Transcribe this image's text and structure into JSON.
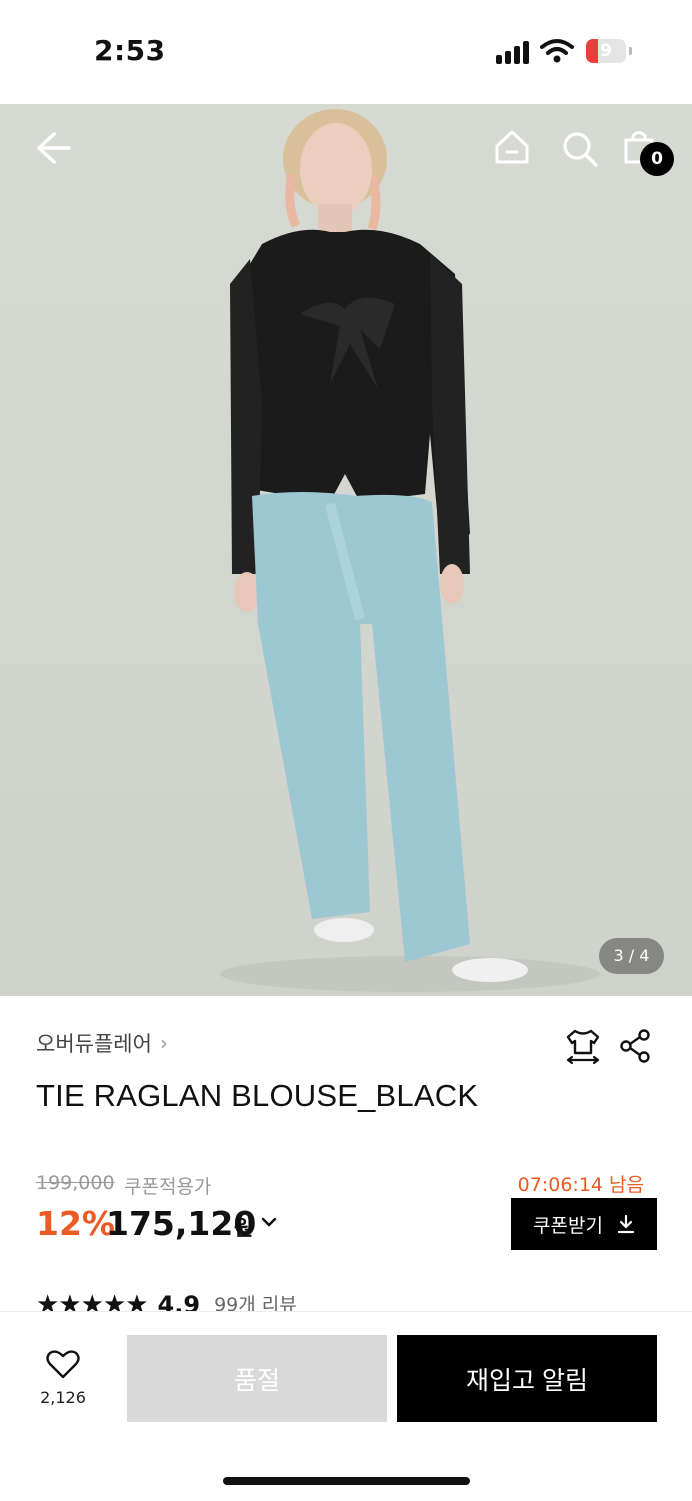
{
  "status_bar": {
    "time": "2:53",
    "battery": "9"
  },
  "header": {
    "icons": [
      "back-arrow-icon",
      "home-icon",
      "search-icon",
      "shopping-bag-icon"
    ],
    "cart_count": "0"
  },
  "gallery": {
    "page_indicator": "3 / 4"
  },
  "product": {
    "brand": "오버듀플레어",
    "title": "TIE RAGLAN BLOUSE_BLACK",
    "original_price": "199,000",
    "coupon_label": "쿠폰적용가",
    "discount": "12%",
    "price": "175,120",
    "currency": "원",
    "timer": "07:06:14 남음",
    "coupon_button": "쿠폰받기",
    "rating": "4.9",
    "stars": "★★★★★",
    "review_count": "99개 리뷰"
  },
  "actions": {
    "wish_count": "2,126",
    "soldout_label": "품절",
    "restock_label": "재입고 알림"
  },
  "colors": {
    "accent": "#ec5b24",
    "primary": "#000000",
    "disabled": "#d9d9d9"
  }
}
